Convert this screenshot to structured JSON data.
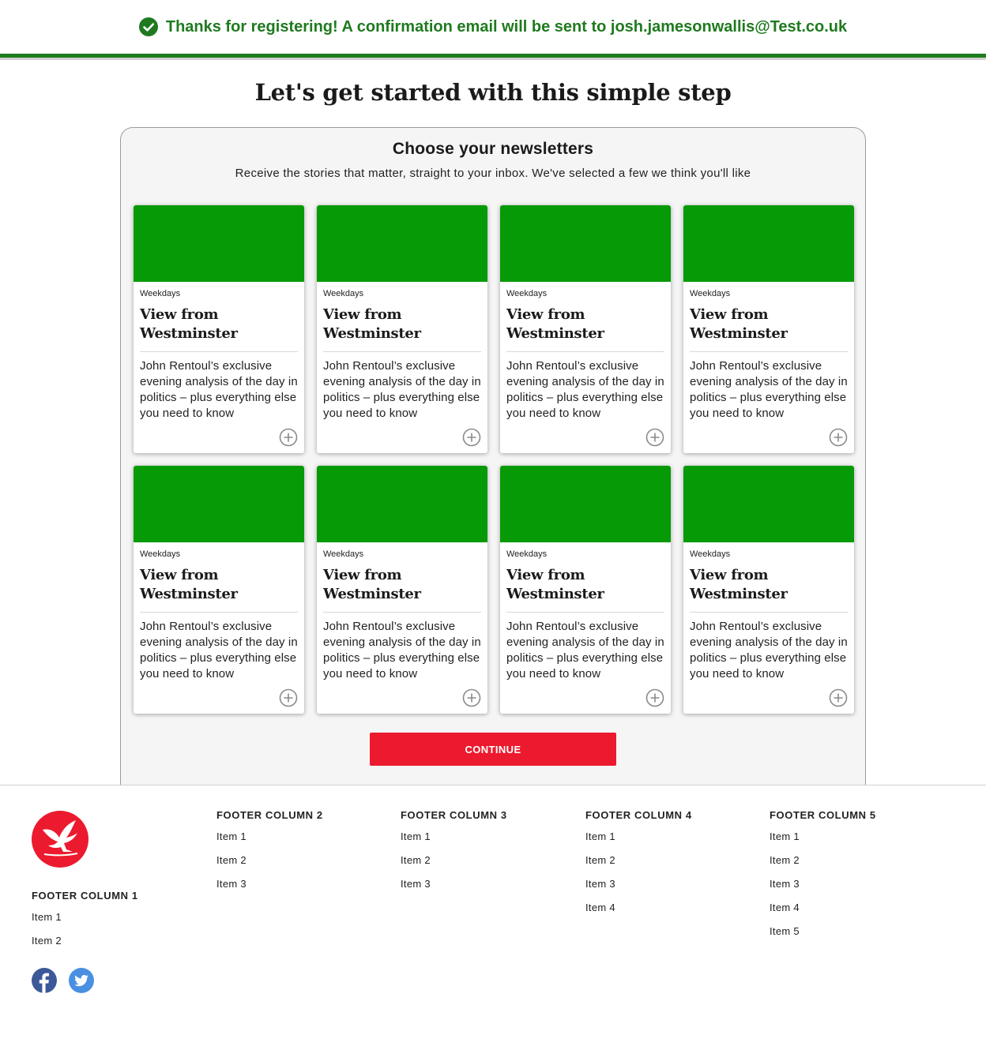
{
  "banner": {
    "message": "Thanks for registering! A confirmation email will be sent to josh.jamesonwallis@Test.co.uk",
    "icon": "check-circle-icon",
    "color": "#1f7a1f"
  },
  "page": {
    "title": "Let's get started with this simple step"
  },
  "newsletters": {
    "heading": "Choose your newsletters",
    "subtitle": "Receive the stories that matter, straight to your inbox. We've selected a few we think you'll like",
    "cards": [
      {
        "frequency": "Weekdays",
        "title": "View from Westminster",
        "description": "John Rentoul’s exclusive evening analysis of the day in politics – plus everything else you need to know"
      },
      {
        "frequency": "Weekdays",
        "title": "View from Westminster",
        "description": "John Rentoul’s exclusive evening analysis of the day in politics – plus everything else you need to know"
      },
      {
        "frequency": "Weekdays",
        "title": "View from Westminster",
        "description": "John Rentoul’s exclusive evening analysis of the day in politics – plus everything else you need to know"
      },
      {
        "frequency": "Weekdays",
        "title": "View from Westminster",
        "description": "John Rentoul’s exclusive evening analysis of the day in politics – plus everything else you need to know"
      },
      {
        "frequency": "Weekdays",
        "title": "View from Westminster",
        "description": "John Rentoul’s exclusive evening analysis of the day in politics – plus everything else you need to know"
      },
      {
        "frequency": "Weekdays",
        "title": "View from Westminster",
        "description": "John Rentoul’s exclusive evening analysis of the day in politics – plus everything else you need to know"
      },
      {
        "frequency": "Weekdays",
        "title": "View from Westminster",
        "description": "John Rentoul’s exclusive evening analysis of the day in politics – plus everything else you need to know"
      },
      {
        "frequency": "Weekdays",
        "title": "View from Westminster",
        "description": "John Rentoul’s exclusive evening analysis of the day in politics – plus everything else you need to know"
      }
    ],
    "card_image_color": "#069a06",
    "continue_label": "CONTINUE",
    "continue_color": "#ec1a2e"
  },
  "footer": {
    "logo_icon": "eagle-logo-icon",
    "columns": [
      {
        "heading": "FOOTER COLUMN 1",
        "items": [
          "Item 1",
          "Item 2"
        ]
      },
      {
        "heading": "FOOTER COLUMN 2",
        "items": [
          "Item 1",
          "Item 2",
          "Item 3"
        ]
      },
      {
        "heading": "FOOTER COLUMN 3",
        "items": [
          "Item 1",
          "Item 2",
          "Item 3"
        ]
      },
      {
        "heading": "FOOTER COLUMN 4",
        "items": [
          "Item 1",
          "Item 2",
          "Item 3",
          "Item 4"
        ]
      },
      {
        "heading": "FOOTER COLUMN 5",
        "items": [
          "Item 1",
          "Item 2",
          "Item 3",
          "Item 4",
          "Item 5"
        ]
      }
    ],
    "social": [
      {
        "name": "facebook-icon",
        "color": "#3b5998"
      },
      {
        "name": "twitter-icon",
        "color": "#4a90e2"
      }
    ]
  }
}
